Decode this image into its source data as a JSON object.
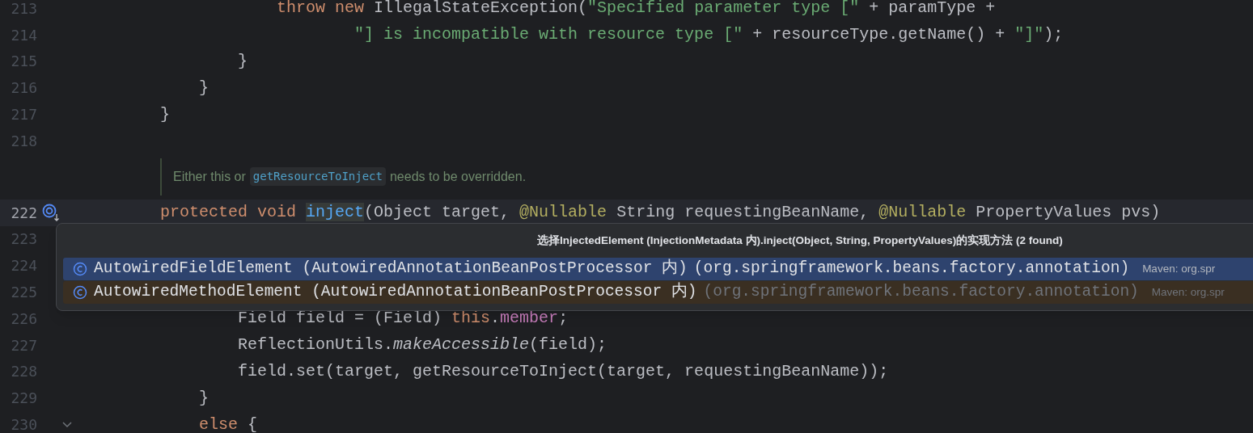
{
  "editor": {
    "lines": [
      {
        "kind": "code",
        "number": "213",
        "current": false,
        "tokens": [
          {
            "kind": "keyword",
            "text": "                    throw new "
          },
          {
            "kind": "plain",
            "text": "IllegalStateException("
          },
          {
            "kind": "string",
            "text": "\"Specified parameter type [\""
          },
          {
            "kind": "plain",
            "text": " + paramType +"
          }
        ]
      },
      {
        "kind": "code",
        "number": "214",
        "current": false,
        "tokens": [
          {
            "kind": "string",
            "text": "                            \"] is incompatible with resource type [\""
          },
          {
            "kind": "plain",
            "text": " + resourceType.getName() + "
          },
          {
            "kind": "string",
            "text": "\"]\""
          },
          {
            "kind": "plain",
            "text": ");"
          }
        ]
      },
      {
        "kind": "code",
        "number": "215",
        "current": false,
        "tokens": [
          {
            "kind": "plain",
            "text": "                }"
          }
        ]
      },
      {
        "kind": "code",
        "number": "216",
        "current": false,
        "tokens": [
          {
            "kind": "plain",
            "text": "            }"
          }
        ]
      },
      {
        "kind": "code",
        "number": "217",
        "current": false,
        "tokens": [
          {
            "kind": "plain",
            "text": "        }"
          }
        ]
      },
      {
        "kind": "code",
        "number": "218",
        "current": false
      },
      {
        "kind": "doc",
        "before": "Either this or",
        "code": "getResourceToInject",
        "after": "needs to be overridden."
      },
      {
        "kind": "code",
        "number": "222",
        "current": true,
        "has_implementations": true,
        "tokens": [
          {
            "kind": "keyword",
            "text": "        protected void "
          },
          {
            "kind": "declaration",
            "text": "inject"
          },
          {
            "kind": "plain",
            "text": "(Object target, "
          },
          {
            "kind": "annotation",
            "text": "@Nullable"
          },
          {
            "kind": "plain",
            "text": " String requestingBeanName, "
          },
          {
            "kind": "annotation",
            "text": "@Nullable"
          },
          {
            "kind": "plain",
            "text": " PropertyValues pvs)"
          }
        ]
      },
      {
        "kind": "code",
        "number": "223",
        "current": false
      },
      {
        "kind": "code",
        "number": "224",
        "current": false
      },
      {
        "kind": "code",
        "number": "225",
        "current": false
      },
      {
        "kind": "code",
        "number": "226",
        "current": false,
        "tokens": [
          {
            "kind": "plain",
            "text": "                Field field = (Field) "
          },
          {
            "kind": "keyword",
            "text": "this"
          },
          {
            "kind": "plain",
            "text": "."
          },
          {
            "kind": "field",
            "text": "member"
          },
          {
            "kind": "plain",
            "text": ";"
          }
        ]
      },
      {
        "kind": "code",
        "number": "227",
        "current": false,
        "tokens": [
          {
            "kind": "plain",
            "text": "                ReflectionUtils."
          },
          {
            "kind": "static",
            "text": "makeAccessible"
          },
          {
            "kind": "plain",
            "text": "(field);"
          }
        ]
      },
      {
        "kind": "code",
        "number": "228",
        "current": false,
        "tokens": [
          {
            "kind": "plain",
            "text": "                field.set(target, getResourceToInject(target, requestingBeanName));"
          }
        ]
      },
      {
        "kind": "code",
        "number": "229",
        "current": false,
        "tokens": [
          {
            "kind": "plain",
            "text": "            }"
          }
        ]
      },
      {
        "kind": "code",
        "number": "230",
        "current": false,
        "fold": true,
        "tokens": [
          {
            "kind": "keyword",
            "text": "            else"
          },
          {
            "kind": "plain",
            "text": " {"
          }
        ]
      }
    ]
  },
  "popup": {
    "title": "选择InjectedElement (InjectionMetadata 内).inject(Object, String, PropertyValues)的实现方法 (2 found)",
    "items": [
      {
        "name": "AutowiredFieldElement (AutowiredAnnotationBeanPostProcessor 内)",
        "package": "(org.springframework.beans.factory.annotation)",
        "location": "Maven: org.spr",
        "selected": true
      },
      {
        "name": "AutowiredMethodElement (AutowiredAnnotationBeanPostProcessor 内)",
        "package": "(org.springframework.beans.factory.annotation)",
        "location": "Maven: org.spr",
        "selected": false
      }
    ]
  }
}
